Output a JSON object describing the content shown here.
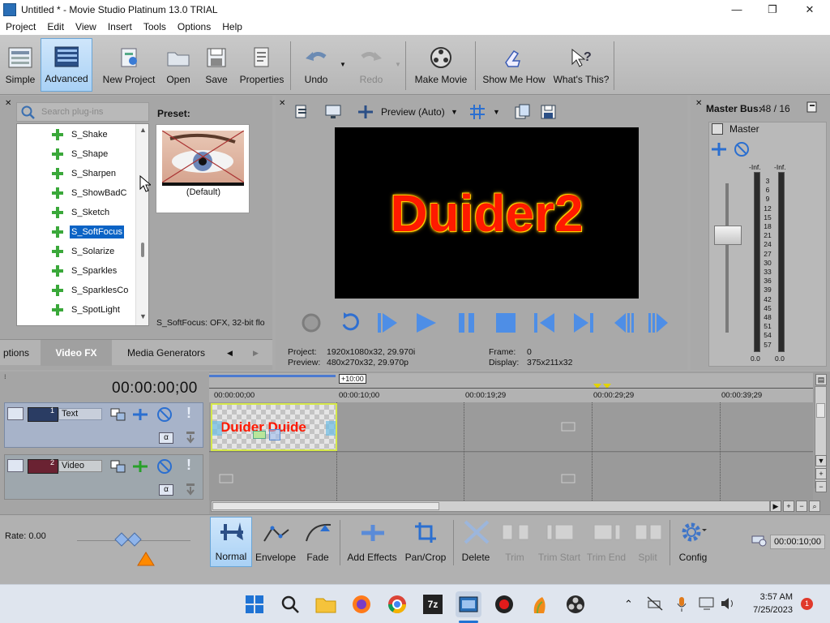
{
  "window": {
    "title": "Untitled * - Movie Studio Platinum 13.0 TRIAL",
    "minimize": "—",
    "maximize": "❐",
    "close": "✕"
  },
  "menu": [
    "Project",
    "Edit",
    "View",
    "Insert",
    "Tools",
    "Options",
    "Help"
  ],
  "toolbar": {
    "simple": "Simple",
    "advanced": "Advanced",
    "new_project": "New Project",
    "open": "Open",
    "save": "Save",
    "properties": "Properties",
    "undo": "Undo",
    "redo": "Redo",
    "make_movie": "Make Movie",
    "show_me_how": "Show Me How",
    "whats_this": "What's This?"
  },
  "plugins": {
    "search_placeholder": "Search plug-ins",
    "items": [
      "S_Shake",
      "S_Shape",
      "S_Sharpen",
      "S_ShowBadC",
      "S_Sketch",
      "S_SoftFocus",
      "S_Solarize",
      "S_Sparkles",
      "S_SparklesCo",
      "S_SpotLight"
    ],
    "selected": "S_SoftFocus",
    "preset_label": "Preset:",
    "preset_name": "(Default)",
    "status": "S_SoftFocus: OFX, 32-bit flo"
  },
  "tabs": {
    "partial": "ptions",
    "video_fx": "Video FX",
    "media_generators": "Media Generators",
    "prev": "◀",
    "next": "▶"
  },
  "preview": {
    "mode": "Preview (Auto)",
    "video_text": "Duider2",
    "project_label": "Project:",
    "project_value": "1920x1080x32, 29.970i",
    "preview_label": "Preview:",
    "preview_value": "480x270x32, 29.970p",
    "frame_label": "Frame:",
    "frame_value": "0",
    "display_label": "Display:",
    "display_value": "375x211x32"
  },
  "master": {
    "title": "Master Bus:",
    "channels": "48 / 16",
    "label": "Master",
    "inf_left": "-Inf.",
    "inf_right": "-Inf.",
    "scale": [
      "3",
      "6",
      "9",
      "12",
      "15",
      "18",
      "21",
      "24",
      "27",
      "30",
      "33",
      "36",
      "39",
      "42",
      "45",
      "48",
      "51",
      "54",
      "57"
    ],
    "foot_left": "0.0",
    "foot_right": "0.0"
  },
  "timeline": {
    "time": "00:00:00;00",
    "marker": "+10:00",
    "ticks": [
      "00:00:00;00",
      "00:00:10;00",
      "00:00:19;29",
      "00:00:29;29",
      "00:00:39;29"
    ],
    "tracks": [
      {
        "num": "1",
        "name": "Text"
      },
      {
        "num": "2",
        "name": "Video"
      }
    ],
    "clip_text": "Duider Duide",
    "alpha": "α"
  },
  "bottom": {
    "rate": "Rate: 0.00",
    "normal": "Normal",
    "envelope": "Envelope",
    "fade": "Fade",
    "add_effects": "Add Effects",
    "pan_crop": "Pan/Crop",
    "delete": "Delete",
    "trim": "Trim",
    "trim_start": "Trim Start",
    "trim_end": "Trim End",
    "split": "Split",
    "config": "Config",
    "duration": "00:00:10;00"
  },
  "taskbar": {
    "time": "3:57 AM",
    "date": "7/25/2023",
    "notif": "1",
    "app_7z": "7z"
  },
  "colors": {
    "accent_blue": "#0b63c5",
    "clip_border": "#d6e84a",
    "video_text": "#ff1a00",
    "plus_green": "#3aa83a"
  }
}
